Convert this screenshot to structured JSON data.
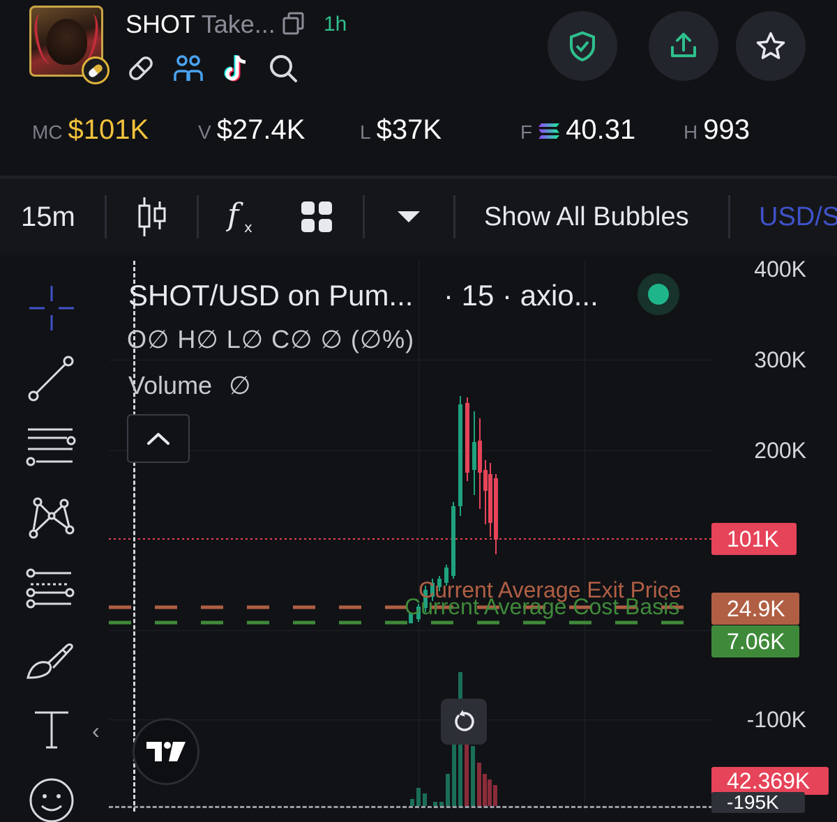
{
  "header": {
    "ticker": "SHOT",
    "name_truncated": "Take...",
    "age": "1h",
    "icons": [
      "pill-icon",
      "link-icon",
      "holders-icon",
      "tiktok-icon",
      "search-icon",
      "copy-icon"
    ],
    "actions": [
      "shield-check-icon",
      "share-icon",
      "star-icon"
    ]
  },
  "stats": {
    "mc_label": "MC",
    "mc_value": "$101K",
    "v_label": "V",
    "v_value": "$27.4K",
    "l_label": "L",
    "l_value": "$37K",
    "f_label": "F",
    "f_value": "40.31",
    "h_label": "H",
    "h_value": "993"
  },
  "toolbar": {
    "interval": "15m",
    "bubbles": "Show All Bubbles",
    "currency": "USD/S"
  },
  "legend": {
    "title": "SHOT/USD on Pum...",
    "interval": "· 15 · axio...",
    "ohlc": "O∅ H∅ L∅ C∅ ∅ (∅%)",
    "volume_label": "Volume",
    "volume_value": "∅"
  },
  "axis": {
    "labels": [
      "400K",
      "300K",
      "200K",
      "-100K"
    ],
    "tags": {
      "current": "101K",
      "exit": "24.9K",
      "cost": "7.06K",
      "bottom1": "42.369K",
      "bottom2": "-195K"
    }
  },
  "overlays": {
    "exit_label": "Current Average Exit Price",
    "cost_label": "Current Average Cost Basis"
  },
  "colors": {
    "up": "#1fa37f",
    "down": "#e64459",
    "exit": "#b05f44",
    "cost": "#3f8a3a",
    "accent": "#f2c23b"
  }
}
